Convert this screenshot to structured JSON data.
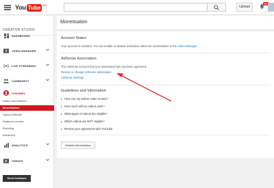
{
  "header": {
    "logo_you": "You",
    "logo_tube": "Tube",
    "logo_region": "GB",
    "search_placeholder": "",
    "upload_label": "Upload",
    "notif_count": "99+"
  },
  "sidebar": {
    "title": "CREATOR STUDIO",
    "items": {
      "dashboard": "DASHBOARD",
      "video_manager": "VIDEO MANAGER",
      "live_streaming": "LIVE STREAMING",
      "community": "COMMUNITY",
      "channel": "CHANNEL",
      "analytics": "ANALYTICS",
      "create": "CREATE"
    },
    "channel_subitems": [
      "Status and features",
      "Monetisation",
      "Upload defaults",
      "Featured content",
      "Branding",
      "Advanced"
    ],
    "feedback_label": "Send feedback"
  },
  "main": {
    "title": "Monetisation",
    "account_status_title": "Account Status",
    "account_status_text": "Your account is enabled. You can enable or disable individual videos for monetisation in the ",
    "video_manager_link": "Video Manager",
    "adsense_title": "AdSense Association",
    "adsense_text": "The AdSense account that you associated has now been approved.",
    "review_link": "Review or change AdSense association",
    "settings_link": "AdSense Settings",
    "guidelines_title": "Guidelines and Information",
    "faqs": [
      "How can my videos make money?",
      "How much will my videos earn?",
      "What types of videos are eligible?",
      "Which videos are NOT eligible?",
      "Review your agreement with YouTube"
    ],
    "disable_button": "Disable Monetisation"
  },
  "colors": {
    "accent_red": "#cc181e",
    "link_blue": "#167ac6",
    "annotation_arrow": "#e0272d"
  }
}
